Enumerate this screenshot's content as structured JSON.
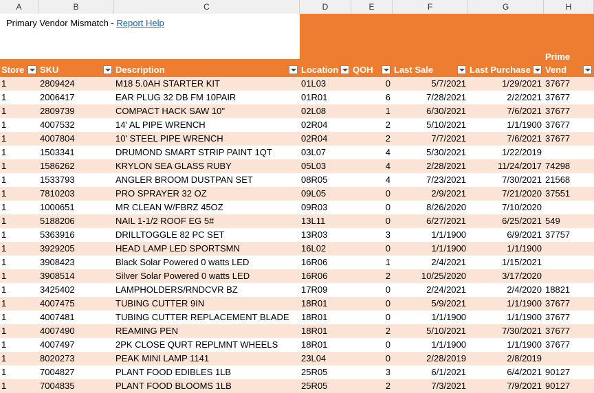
{
  "column_letters": [
    "A",
    "B",
    "C",
    "D",
    "E",
    "F",
    "G",
    "H"
  ],
  "title": {
    "text": "Primary Vendor Mismatch - ",
    "link": "Report Help"
  },
  "headers": {
    "store": "Store",
    "sku": "SKU",
    "description": "Description",
    "location": "Location",
    "qoh": "QOH",
    "last_sale": "Last Sale",
    "last_purchase": "Last Purchase",
    "prime_top": "Prime",
    "prime_bottom": "Vend"
  },
  "colors": {
    "accent": "#ed7d31",
    "band": "#fbe4d5",
    "link": "#0563c1"
  },
  "rows": [
    [
      "1",
      "2809424",
      "M18 5.0AH STARTER KIT",
      "01L03",
      "0",
      "5/7/2021",
      "1/29/2021",
      "37677"
    ],
    [
      "1",
      "2006417",
      "EAR PLUG 32 DB FM 10PAIR",
      "01R01",
      "6",
      "7/28/2021",
      "2/2/2021",
      "37677"
    ],
    [
      "1",
      "2809739",
      "COMPACT HACK SAW 10\"",
      "02L08",
      "1",
      "6/30/2021",
      "7/6/2021",
      "37677"
    ],
    [
      "1",
      "4007532",
      "14' AL PIPE WRENCH",
      "02R04",
      "2",
      "5/10/2021",
      "1/1/1900",
      "37677"
    ],
    [
      "1",
      "4007804",
      "10' STEEL PIPE WRENCH",
      "02R04",
      "2",
      "7/7/2021",
      "7/6/2021",
      "37677"
    ],
    [
      "1",
      "1503341",
      "DRUMOND SMART STRIP PAINT 1QT",
      "03L07",
      "4",
      "5/30/2021",
      "1/22/2019",
      ""
    ],
    [
      "1",
      "1586262",
      "KRYLON SEA GLASS RUBY",
      "05L03",
      "4",
      "2/28/2021",
      "11/24/2017",
      "74298"
    ],
    [
      "1",
      "1533793",
      "ANGLER BROOM DUSTPAN SET",
      "08R05",
      "4",
      "7/23/2021",
      "7/30/2021",
      "21568"
    ],
    [
      "1",
      "7810203",
      "PRO SPRAYER 32 OZ",
      "09L05",
      "0",
      "2/9/2021",
      "7/21/2020",
      "37551"
    ],
    [
      "1",
      "1000651",
      "MR CLEAN W/FBRZ 45OZ",
      "09R03",
      "0",
      "8/26/2020",
      "7/10/2020",
      ""
    ],
    [
      "1",
      "5188206",
      "NAIL 1-1/2 ROOF EG 5#",
      "13L11",
      "0",
      "6/27/2021",
      "6/25/2021",
      "549"
    ],
    [
      "1",
      "5363916",
      "DRILLTOGGLE 82 PC SET",
      "13R03",
      "3",
      "1/1/1900",
      "6/9/2021",
      "37757"
    ],
    [
      "1",
      "3929205",
      "HEAD LAMP LED SPORTSMN",
      "16L02",
      "0",
      "1/1/1900",
      "1/1/1900",
      ""
    ],
    [
      "1",
      "3908423",
      "Black Solar Powered 0 watts LED",
      "16R06",
      "1",
      "2/4/2021",
      "1/15/2021",
      ""
    ],
    [
      "1",
      "3908514",
      "Silver Solar Powered 0 watts LED",
      "16R06",
      "2",
      "10/25/2020",
      "3/17/2020",
      ""
    ],
    [
      "1",
      "3425402",
      "LAMPHOLDERS/RNDCVR BZ",
      "17R09",
      "0",
      "2/24/2021",
      "2/4/2020",
      "18821"
    ],
    [
      "1",
      "4007475",
      "TUBING CUTTER 9IN",
      "18R01",
      "0",
      "5/9/2021",
      "1/1/1900",
      "37677"
    ],
    [
      "1",
      "4007481",
      "TUBING CUTTER REPLACEMENT BLADE",
      "18R01",
      "0",
      "1/1/1900",
      "1/1/1900",
      "37677"
    ],
    [
      "1",
      "4007490",
      "REAMING PEN",
      "18R01",
      "2",
      "5/10/2021",
      "7/30/2021",
      "37677"
    ],
    [
      "1",
      "4007497",
      "2PK CLOSE QURT REPLMNT WHEELS",
      "18R01",
      "0",
      "1/1/1900",
      "1/1/1900",
      "37677"
    ],
    [
      "1",
      "8020273",
      "PEAK MINI LAMP 1141",
      "23L04",
      "0",
      "2/28/2019",
      "2/8/2019",
      ""
    ],
    [
      "1",
      "7004827",
      "PLANT FOOD EDIBLES 1LB",
      "25R05",
      "3",
      "6/1/2021",
      "6/4/2021",
      "90127"
    ],
    [
      "1",
      "7004835",
      "PLANT FOOD BLOOMS 1LB",
      "25R05",
      "2",
      "7/3/2021",
      "7/9/2021",
      "90127"
    ]
  ]
}
